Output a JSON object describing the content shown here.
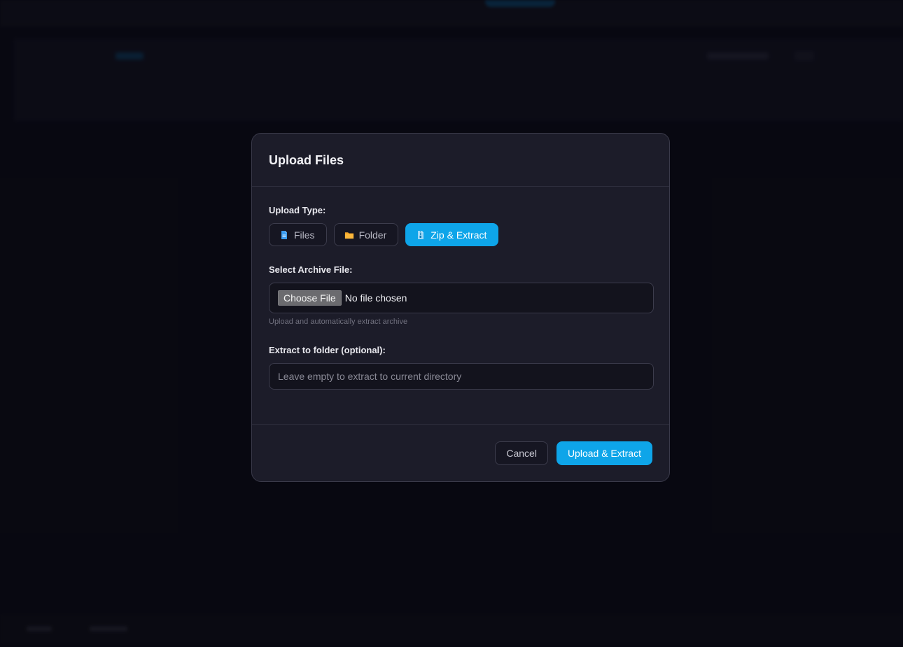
{
  "modal": {
    "title": "Upload Files",
    "upload_type_label": "Upload Type:",
    "upload_types": [
      {
        "label": "Files",
        "icon": "file-icon",
        "active": false
      },
      {
        "label": "Folder",
        "icon": "folder-icon",
        "active": false
      },
      {
        "label": "Zip & Extract",
        "icon": "archive-file-icon",
        "active": true
      }
    ],
    "archive_label": "Select Archive File:",
    "choose_file_label": "Choose File",
    "file_status": "No file chosen",
    "archive_hint": "Upload and automatically extract archive",
    "extract_label": "Extract to folder (optional):",
    "extract_placeholder": "Leave empty to extract to current directory",
    "extract_value": "",
    "cancel_label": "Cancel",
    "submit_label": "Upload & Extract"
  },
  "colors": {
    "accent": "#0ea5e9",
    "modal_bg": "#1c1c29",
    "folder_icon": "#f5a524",
    "file_icon": "#3b9cf0"
  }
}
